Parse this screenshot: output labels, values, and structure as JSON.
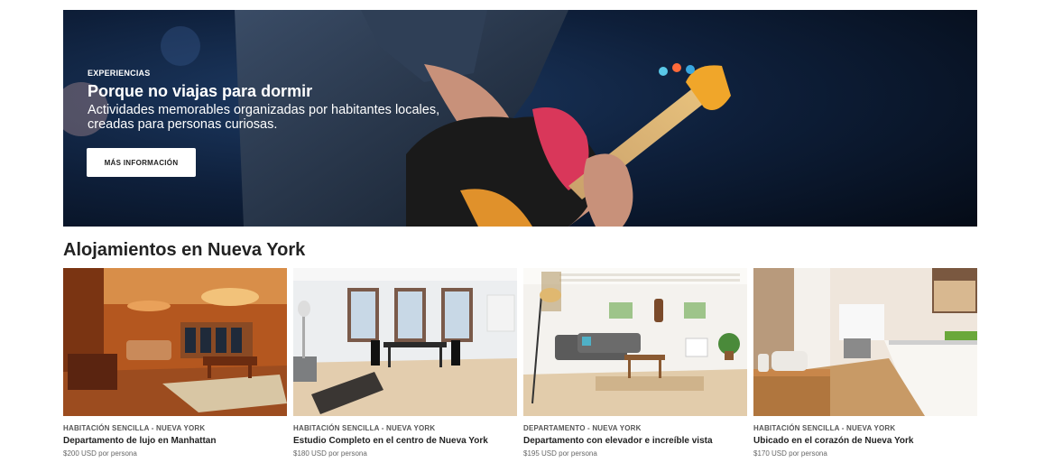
{
  "hero": {
    "kicker": "EXPERIENCIAS",
    "title": "Porque no viajas para dormir",
    "subtitle": "Actividades memorables organizadas por habitantes locales, creadas para personas curiosas.",
    "button_label": "MÁS INFORMACIÓN"
  },
  "section": {
    "title": "Alojamientos en Nueva York"
  },
  "listings": [
    {
      "category": "HABITACIÓN SENCILLA - NUEVA YORK",
      "title": "Departamento de lujo en Manhattan",
      "price": "$200 USD por persona"
    },
    {
      "category": "HABITACIÓN SENCILLA - NUEVA YORK",
      "title": "Estudio Completo en el centro de Nueva York",
      "price": "$180 USD por persona"
    },
    {
      "category": "DEPARTAMENTO - NUEVA YORK",
      "title": "Departamento con elevador e increíble vista",
      "price": "$195 USD por persona"
    },
    {
      "category": "HABITACIÓN SENCILLA - NUEVA YORK",
      "title": "Ubicado en el corazón de Nueva York",
      "price": "$170 USD por persona"
    }
  ]
}
